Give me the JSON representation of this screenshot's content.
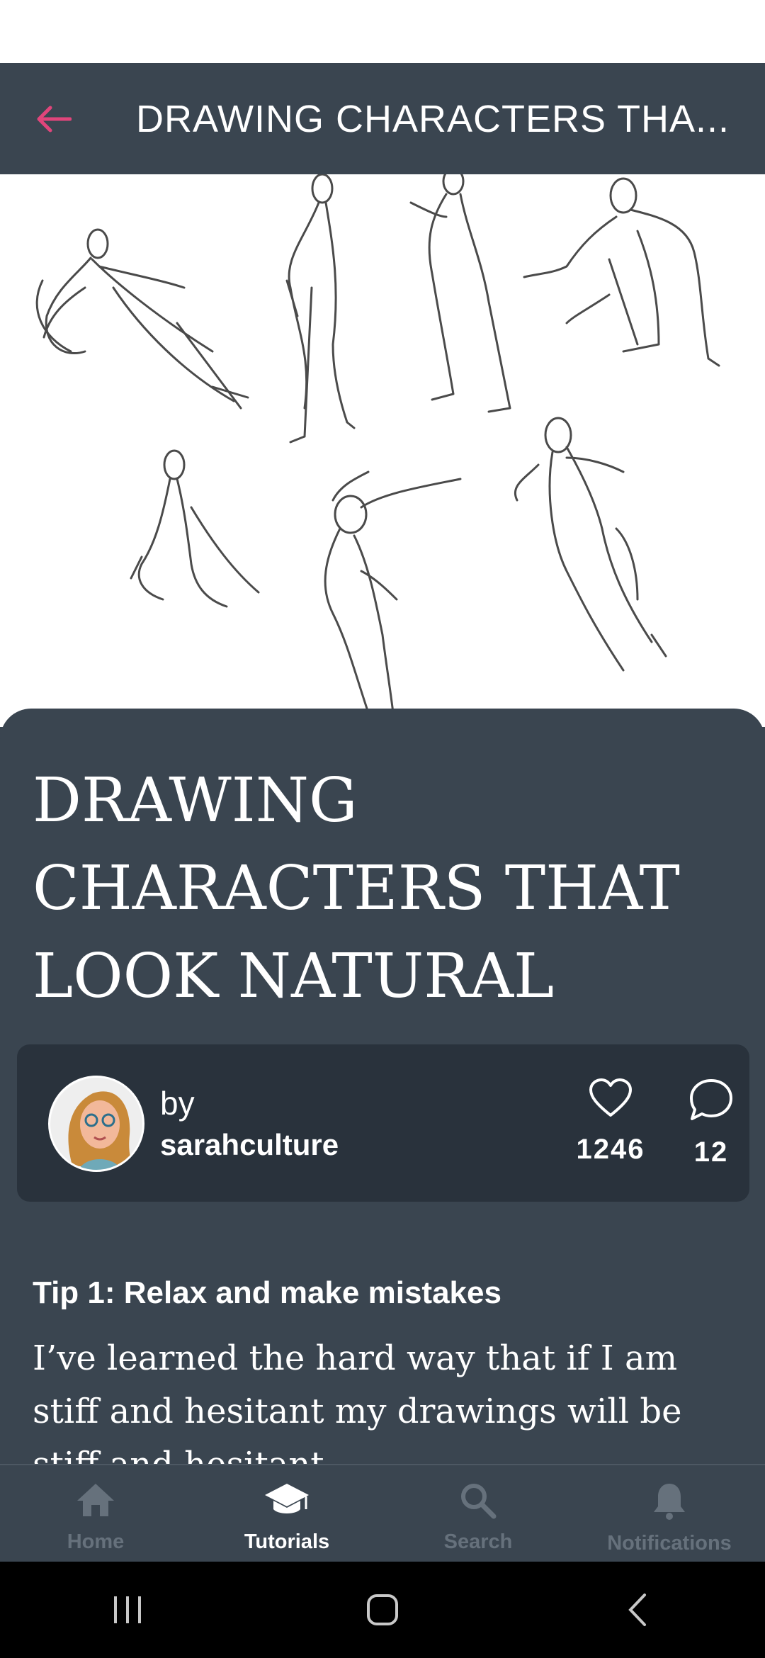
{
  "app_bar": {
    "title": "DRAWING CHARACTERS THA...",
    "back_icon": "arrow-left-icon",
    "accent_color": "#e0457b"
  },
  "article": {
    "title": "DRAWING CHARACTERS THAT LOOK NATURAL",
    "author": {
      "by_label": "by",
      "name": "sarahculture",
      "likes": "1246",
      "comments": "12"
    },
    "tip_heading": "Tip 1: Relax and make mistakes",
    "body": "I’ve learned the hard way that if I am stiff and hesitant my drawings will be stiff and hesitant."
  },
  "bottom_nav": {
    "items": [
      {
        "label": "Home",
        "icon": "home-icon"
      },
      {
        "label": "Tutorials",
        "icon": "graduation-cap-icon"
      },
      {
        "label": "Search",
        "icon": "search-icon"
      },
      {
        "label": "Notifications",
        "icon": "bell-icon"
      }
    ],
    "active": "Tutorials"
  },
  "system_nav": {
    "buttons": [
      "recent-apps",
      "home",
      "back"
    ]
  },
  "colors": {
    "surface": "#3a4550",
    "card": "#29323c",
    "inactive": "#66717c"
  }
}
